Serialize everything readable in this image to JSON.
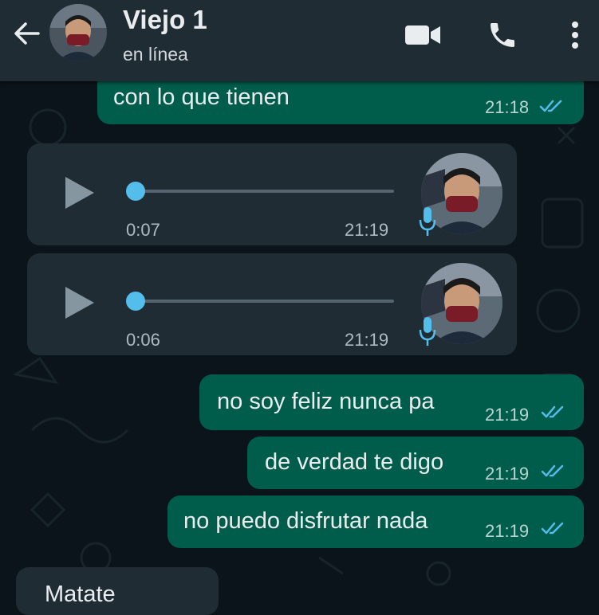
{
  "header": {
    "contact_name": "Viejo 1",
    "status": "en línea",
    "icons": [
      "back-arrow-icon",
      "video-call-icon",
      "phone-icon",
      "more-options-icon"
    ]
  },
  "messages": [
    {
      "type": "text",
      "direction": "outgoing",
      "text": "con lo que tienen",
      "time": "21:18",
      "read": true
    },
    {
      "type": "voice",
      "direction": "incoming",
      "duration": "0:07",
      "time": "21:19",
      "progress": 0
    },
    {
      "type": "voice",
      "direction": "incoming",
      "duration": "0:06",
      "time": "21:19",
      "progress": 0
    },
    {
      "type": "text",
      "direction": "outgoing",
      "text": "no soy feliz nunca pa",
      "time": "21:19",
      "read": true
    },
    {
      "type": "text",
      "direction": "outgoing",
      "text": "de verdad te digo",
      "time": "21:19",
      "read": true
    },
    {
      "type": "text",
      "direction": "outgoing",
      "text": "no puedo disfrutar nada",
      "time": "21:19",
      "read": true
    },
    {
      "type": "text",
      "direction": "incoming",
      "text": "Matate",
      "time": "",
      "partially_visible": true
    }
  ],
  "colors": {
    "background": "#0b141a",
    "header": "#1f2c34",
    "outgoing_bubble": "#005c4b",
    "incoming_bubble": "#1f2c34",
    "read_ticks": "#53bdeb",
    "voice_knob": "#53bdeb"
  }
}
